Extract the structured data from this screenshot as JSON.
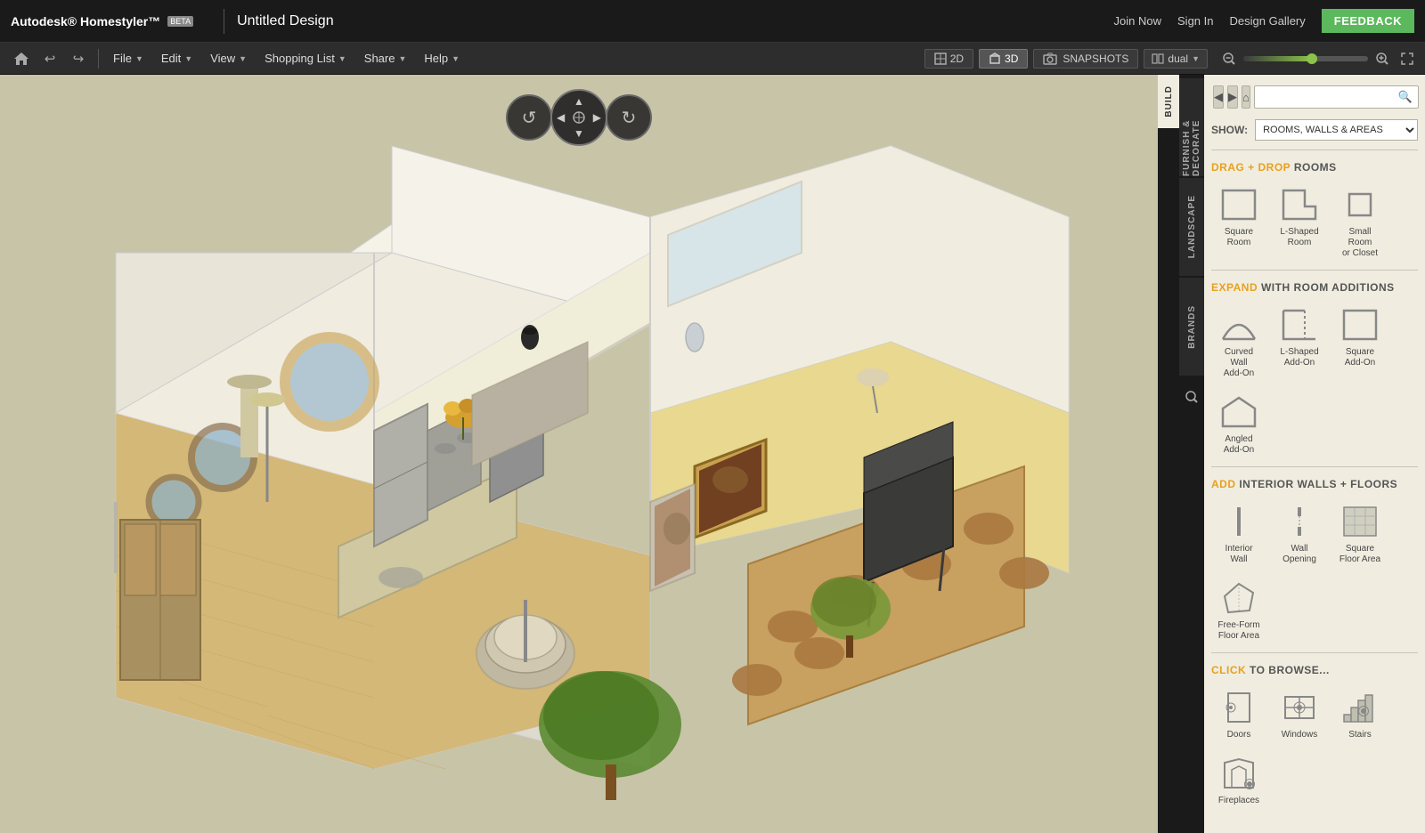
{
  "app": {
    "logo": "Autodesk® Homestyler™",
    "logo_beta": "BETA",
    "title": "Untitled Design",
    "top_links": [
      "Join Now",
      "Sign In",
      "Design Gallery"
    ],
    "feedback_label": "FEEDBACK"
  },
  "menubar": {
    "file": "File",
    "edit": "Edit",
    "view": "View",
    "shopping_list": "Shopping List",
    "share": "Share",
    "help": "Help"
  },
  "view_controls": {
    "btn_2d": "2D",
    "btn_3d": "3D",
    "snapshots": "SNAPSHOTS",
    "dual": "dual"
  },
  "right_panel": {
    "build_tab": "BUILD",
    "side_tabs": [
      "FURNISH & DECORATE",
      "LANDSCAPE",
      "BRANDS"
    ],
    "show_label": "SHOW:",
    "show_option": "ROOMS, WALLS & AREAS",
    "nav_back": "◀",
    "nav_forward": "▶",
    "nav_home": "⌂",
    "sections": {
      "drag_rooms": {
        "prefix": "DRAG + DROP",
        "suffix": "ROOMS",
        "items": [
          {
            "label": "Square\nRoom",
            "shape": "square"
          },
          {
            "label": "L-Shaped\nRoom",
            "shape": "l-shaped"
          },
          {
            "label": "Small Room\nor Closet",
            "shape": "small-room"
          }
        ]
      },
      "expand": {
        "prefix": "EXPAND",
        "suffix": "WITH ROOM ADDITIONS",
        "items": [
          {
            "label": "Curved Wall\nAdd-On",
            "shape": "curved-wall"
          },
          {
            "label": "L-Shaped\nAdd-On",
            "shape": "l-shaped-add"
          },
          {
            "label": "Square\nAdd-On",
            "shape": "square-add"
          },
          {
            "label": "Angled\nAdd-On",
            "shape": "angled-add"
          }
        ]
      },
      "interior": {
        "prefix": "ADD",
        "suffix": "INTERIOR WALLS + FLOORS",
        "items": [
          {
            "label": "Interior\nWall",
            "shape": "interior-wall"
          },
          {
            "label": "Wall\nOpening",
            "shape": "wall-opening"
          },
          {
            "label": "Square\nFloor Area",
            "shape": "square-floor"
          },
          {
            "label": "Free-Form\nFloor Area",
            "shape": "freeform-floor"
          }
        ]
      },
      "browse": {
        "prefix": "CLICK",
        "suffix": "TO BROWSE...",
        "items": [
          {
            "label": "Doors",
            "shape": "door"
          },
          {
            "label": "Windows",
            "shape": "window"
          },
          {
            "label": "Stairs",
            "shape": "stairs"
          },
          {
            "label": "Fireplaces",
            "shape": "fireplace"
          }
        ]
      }
    }
  }
}
